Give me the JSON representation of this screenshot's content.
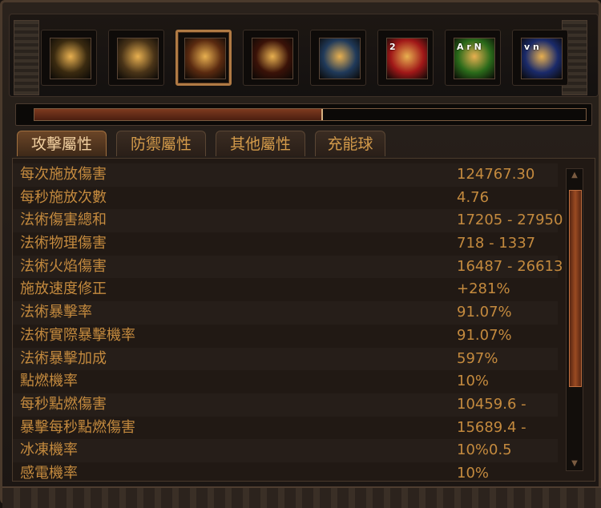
{
  "skills": [
    {
      "icon": "golden-sword-icon",
      "badge": "",
      "selected": false,
      "bg": "#3a2a10"
    },
    {
      "icon": "holy-hand-icon",
      "badge": "",
      "selected": false,
      "bg": "#4a3418"
    },
    {
      "icon": "fire-vortex-icon",
      "badge": "",
      "selected": true,
      "bg": "#5a2a10"
    },
    {
      "icon": "dark-flame-figure-icon",
      "badge": "",
      "selected": false,
      "bg": "#3a1208"
    },
    {
      "icon": "blue-orb-icon",
      "badge": "",
      "selected": false,
      "bg": "#203a5a"
    },
    {
      "icon": "running-figure-icon",
      "badge": "2",
      "selected": false,
      "bg": "#a01818"
    },
    {
      "icon": "fire-dancer-icon",
      "badge": "A r N",
      "selected": false,
      "bg": "#2a6a1a"
    },
    {
      "icon": "white-armor-icon",
      "badge": "v n",
      "selected": false,
      "bg": "#1a2a6a"
    }
  ],
  "progress": {
    "fraction": 0.52
  },
  "tabs": [
    "攻擊屬性",
    "防禦屬性",
    "其他屬性",
    "充能球"
  ],
  "active_tab": 0,
  "stats": [
    {
      "name": "每次施放傷害",
      "value": "124767.30"
    },
    {
      "name": "每秒施放次數",
      "value": "4.76"
    },
    {
      "name": "法術傷害總和",
      "value": "17205 - 27950"
    },
    {
      "name": "法術物理傷害",
      "value": "718 - 1337"
    },
    {
      "name": "法術火焰傷害",
      "value": "16487 - 26613"
    },
    {
      "name": "施放速度修正",
      "value": "+281%"
    },
    {
      "name": "法術暴擊率",
      "value": "91.07%"
    },
    {
      "name": "法術實際暴擊機率",
      "value": "91.07%"
    },
    {
      "name": "法術暴擊加成",
      "value": "597%"
    },
    {
      "name": "點燃機率",
      "value": "10%"
    },
    {
      "name": "每秒點燃傷害",
      "value": "10459.6 -"
    },
    {
      "name": "暴擊每秒點燃傷害",
      "value": "15689.4 -"
    },
    {
      "name": "冰凍機率",
      "value": "10%0.5"
    },
    {
      "name": "感電機率",
      "value": "10%"
    }
  ],
  "colors": {
    "text": "#c48a3e",
    "accent": "#b07a44",
    "fill": "#7e3a1f"
  }
}
